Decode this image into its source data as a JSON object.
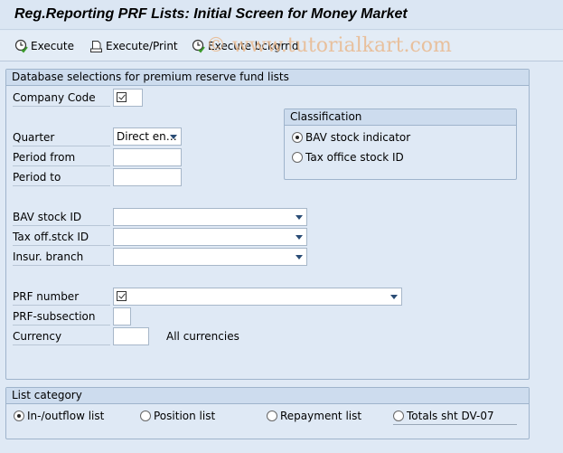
{
  "window": {
    "title": "Reg.Reporting PRF Lists: Initial Screen for Money Market"
  },
  "toolbar": {
    "buttons": [
      {
        "label": "Execute",
        "icon": "execute-clock-icon"
      },
      {
        "label": "Execute/Print",
        "icon": "printer-icon"
      },
      {
        "label": "Execute bckgrnd",
        "icon": "execute-clock-icon"
      }
    ],
    "watermark": "© www.tutorialkart.com"
  },
  "db_selections": {
    "header": "Database selections for premium reserve fund lists",
    "fields": {
      "company_code": {
        "label": "Company Code",
        "value": "",
        "required": true
      },
      "quarter": {
        "label": "Quarter",
        "value": "Direct en…"
      },
      "period_from": {
        "label": "Period from",
        "value": ""
      },
      "period_to": {
        "label": "Period to",
        "value": ""
      },
      "bav_stock_id": {
        "label": "BAV stock ID",
        "value": ""
      },
      "tax_off_stck_id": {
        "label": "Tax off.stck ID",
        "value": ""
      },
      "insur_branch": {
        "label": "Insur. branch",
        "value": ""
      },
      "prf_number": {
        "label": "PRF number",
        "value": "",
        "required": true
      },
      "prf_subsection": {
        "label": "PRF-subsection",
        "value": ""
      },
      "currency": {
        "label": "Currency",
        "value": "",
        "hint": "All currencies"
      }
    },
    "classification": {
      "header": "Classification",
      "options": [
        {
          "label": "BAV stock indicator",
          "selected": true
        },
        {
          "label": "Tax office stock ID",
          "selected": false
        }
      ]
    }
  },
  "list_category": {
    "header": "List category",
    "options": [
      {
        "label": "In-/outflow list",
        "selected": true
      },
      {
        "label": "Position list",
        "selected": false
      },
      {
        "label": "Repayment list",
        "selected": false
      },
      {
        "label": "Totals sht DV-07",
        "selected": false
      }
    ]
  }
}
